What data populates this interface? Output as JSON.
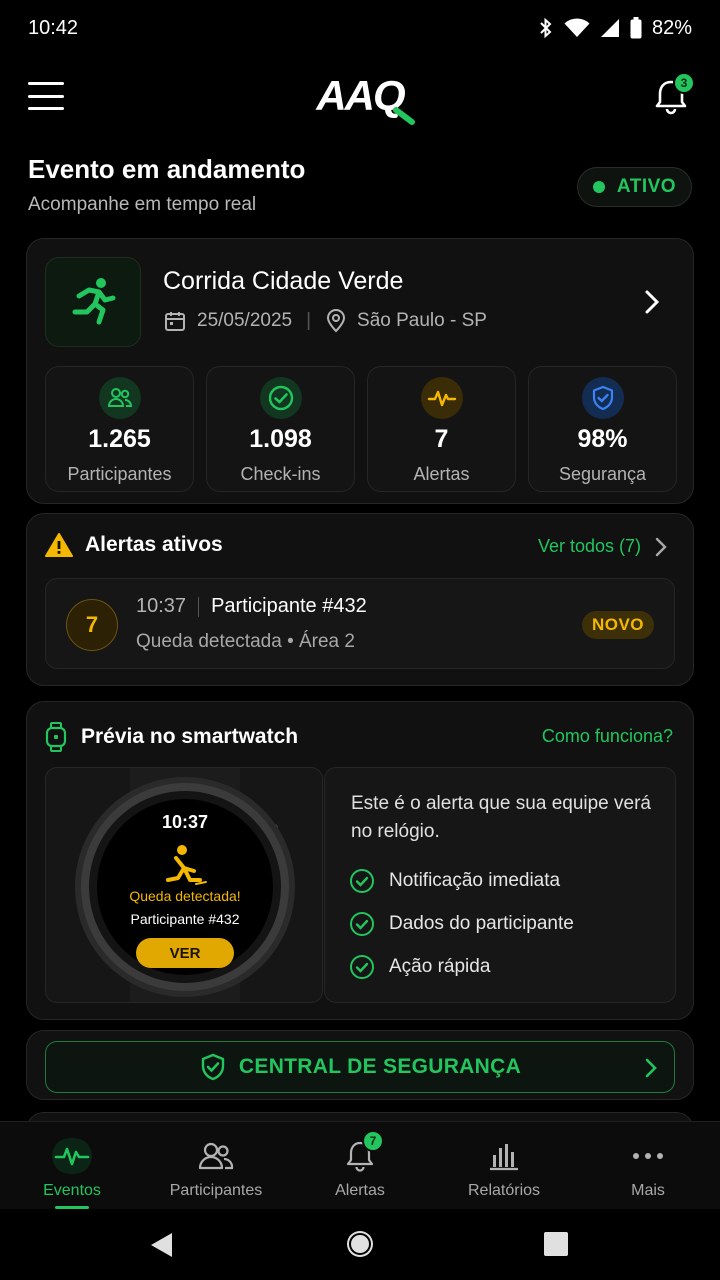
{
  "status_bar": {
    "time": "10:42",
    "battery": "82%"
  },
  "header": {
    "logo_text": "AAQ",
    "notification_count": "3",
    "icons": [
      "menu-icon",
      "bell-icon"
    ]
  },
  "page": {
    "title": "Evento em andamento",
    "subtitle": "Acompanhe em tempo real",
    "status_label": "ATIVO"
  },
  "event": {
    "name": "Corrida Cidade Verde",
    "date": "25/05/2025",
    "location": "São Paulo - SP",
    "stats": [
      {
        "value": "1.265",
        "label": "Participantes",
        "icon": "people-icon",
        "color": "#22c55e"
      },
      {
        "value": "1.098",
        "label": "Check-ins",
        "icon": "check-circle-icon",
        "color": "#22c55e"
      },
      {
        "value": "7",
        "label": "Alertas",
        "icon": "pulse-icon",
        "color": "#f5b800"
      },
      {
        "value": "98%",
        "label": "Segurança",
        "icon": "shield-check-icon",
        "color": "#3b82f6"
      }
    ]
  },
  "alerts": {
    "title": "Alertas ativos",
    "see_all": "Ver todos (7)",
    "item": {
      "number": "7",
      "time": "10:37",
      "participant": "Participante #432",
      "description": "Queda detectada • Área 2",
      "badge": "NOVO"
    }
  },
  "smartwatch": {
    "title": "Prévia no smartwatch",
    "link": "Como funciona?",
    "screen_time": "10:37",
    "screen_alert": "Queda detectada!",
    "screen_participant": "Participante #432",
    "screen_button": "VER",
    "info_text": "Este é o alerta que sua equipe verá no relógio.",
    "features": [
      "Notificação imediata",
      "Dados do participante",
      "Ação rápida"
    ]
  },
  "security": {
    "label": "CENTRAL DE SEGURANÇA"
  },
  "bottom_nav": {
    "items": [
      {
        "label": "Eventos",
        "icon": "pulse-icon",
        "active": true
      },
      {
        "label": "Participantes",
        "icon": "people-icon"
      },
      {
        "label": "Alertas",
        "icon": "bell-icon",
        "badge": "7"
      },
      {
        "label": "Relatórios",
        "icon": "bar-chart-icon"
      },
      {
        "label": "Mais",
        "icon": "more-icon"
      }
    ]
  },
  "colors": {
    "accent": "#22c55e",
    "warning": "#f5b800",
    "info": "#3b82f6",
    "background": "#000000"
  }
}
